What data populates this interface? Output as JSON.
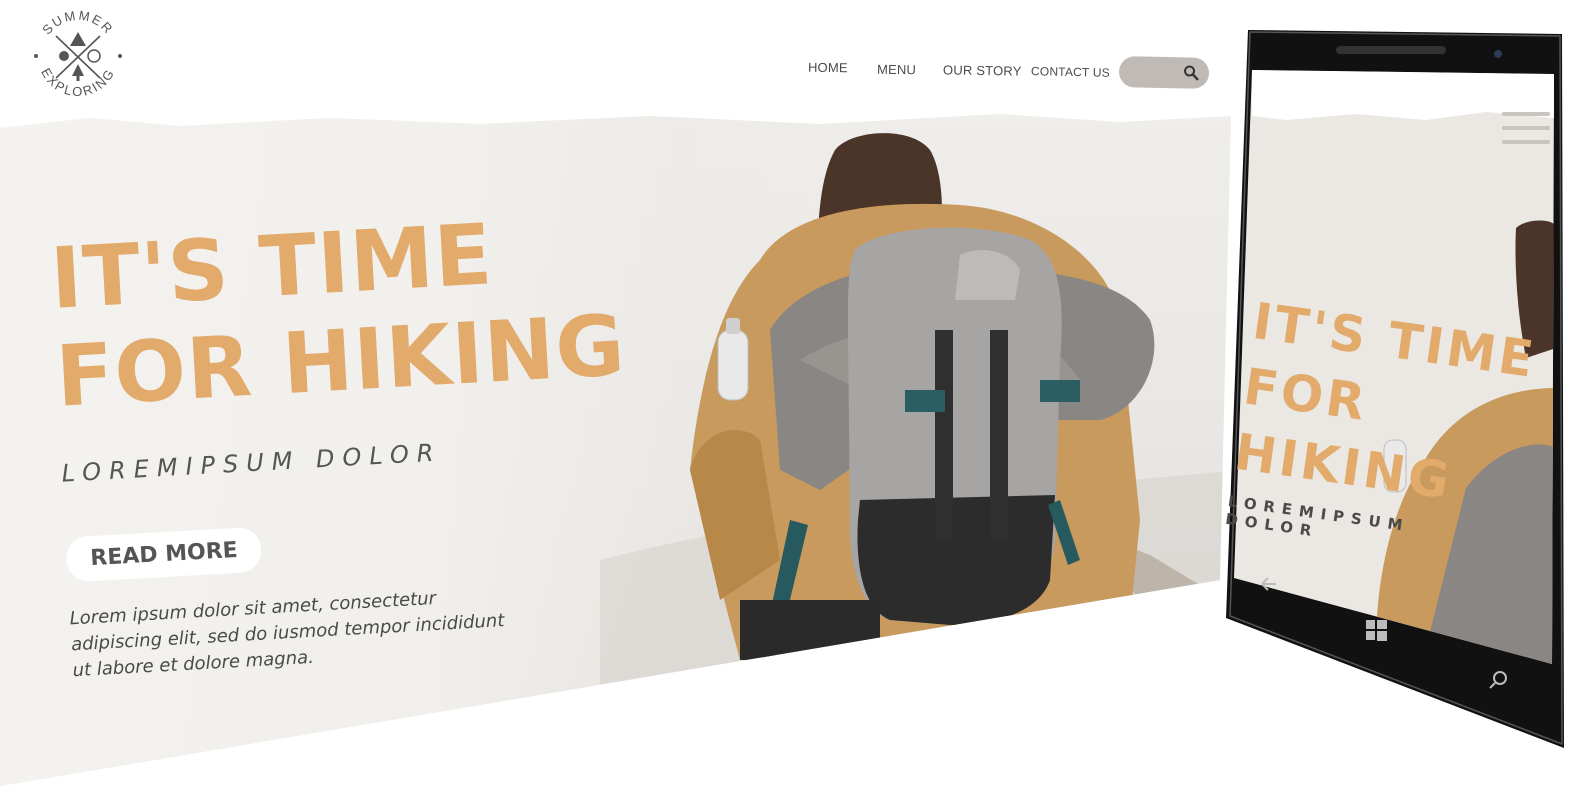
{
  "brand": {
    "logo_top_text": "SUMMER",
    "logo_bottom_text": "EXPLORING"
  },
  "nav": {
    "items": [
      "HOME",
      "MENU",
      "OUR STORY",
      "CONTACT US"
    ]
  },
  "search": {
    "icon": "search-icon"
  },
  "hero": {
    "headline_line1": "IT'S TIME",
    "headline_line2": "FOR HIKING",
    "subtitle": "LOREMIPSUM DOLOR",
    "button_label": "READ MORE",
    "body": "Lorem ipsum dolor sit amet, consectetur adipiscing elit, sed do iusmod tempor incididunt ut labore et dolore magna."
  },
  "phone": {
    "menu_icon": "hamburger-menu-icon",
    "headline_lines": [
      "IT'S TIME",
      "FOR",
      "HIKING"
    ],
    "sub_lines": [
      "LOREMIPSUM",
      "DOLOR"
    ],
    "nav_icons": [
      "back-arrow-icon",
      "windows-logo-icon",
      "search-icon"
    ]
  },
  "colors": {
    "accent": "#e2ab6c",
    "text_dark": "#4a4a4a",
    "search_bg": "#bfbab6",
    "phone_body": "#111111"
  }
}
